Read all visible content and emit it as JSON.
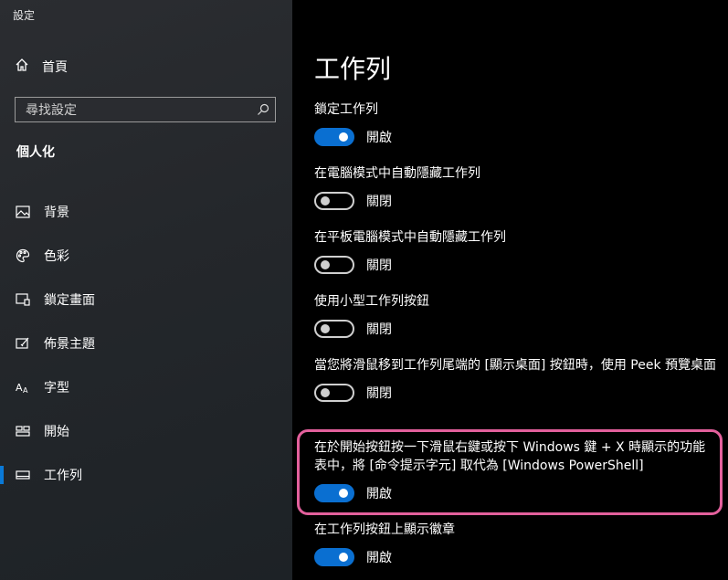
{
  "app": {
    "title": "設定"
  },
  "sidebar": {
    "home_label": "首頁",
    "search_placeholder": "尋找設定",
    "section_title": "個人化",
    "items": [
      {
        "label": "背景",
        "icon": "image-icon"
      },
      {
        "label": "色彩",
        "icon": "palette-icon"
      },
      {
        "label": "鎖定畫面",
        "icon": "lock-screen-icon"
      },
      {
        "label": "佈景主題",
        "icon": "brush-icon"
      },
      {
        "label": "字型",
        "icon": "font-icon"
      },
      {
        "label": "開始",
        "icon": "start-icon"
      },
      {
        "label": "工作列",
        "icon": "taskbar-icon"
      }
    ],
    "active_index": 6,
    "accent": "#0a79d6"
  },
  "main": {
    "title": "工作列",
    "settings": [
      {
        "label": "鎖定工作列",
        "on": true,
        "state": "開啟"
      },
      {
        "label": "在電腦模式中自動隱藏工作列",
        "on": false,
        "state": "關閉"
      },
      {
        "label": "在平板電腦模式中自動隱藏工作列",
        "on": false,
        "state": "關閉"
      },
      {
        "label": "使用小型工作列按鈕",
        "on": false,
        "state": "關閉"
      },
      {
        "label": "當您將滑鼠移到工作列尾端的 [顯示桌面] 按鈕時，使用 Peek 預覽桌面",
        "on": false,
        "state": "關閉"
      },
      {
        "label": "在於開始按鈕按一下滑鼠右鍵或按下 Windows 鍵 + X 時顯示的功能表中，將 [命令提示字元] 取代為 [Windows PowerShell]",
        "on": true,
        "state": "開啟"
      },
      {
        "label": "在工作列按鈕上顯示徽章",
        "on": true,
        "state": "開啟"
      }
    ]
  },
  "colors": {
    "highlight": "#e3609c",
    "toggle_on": "#0a6fd1"
  }
}
